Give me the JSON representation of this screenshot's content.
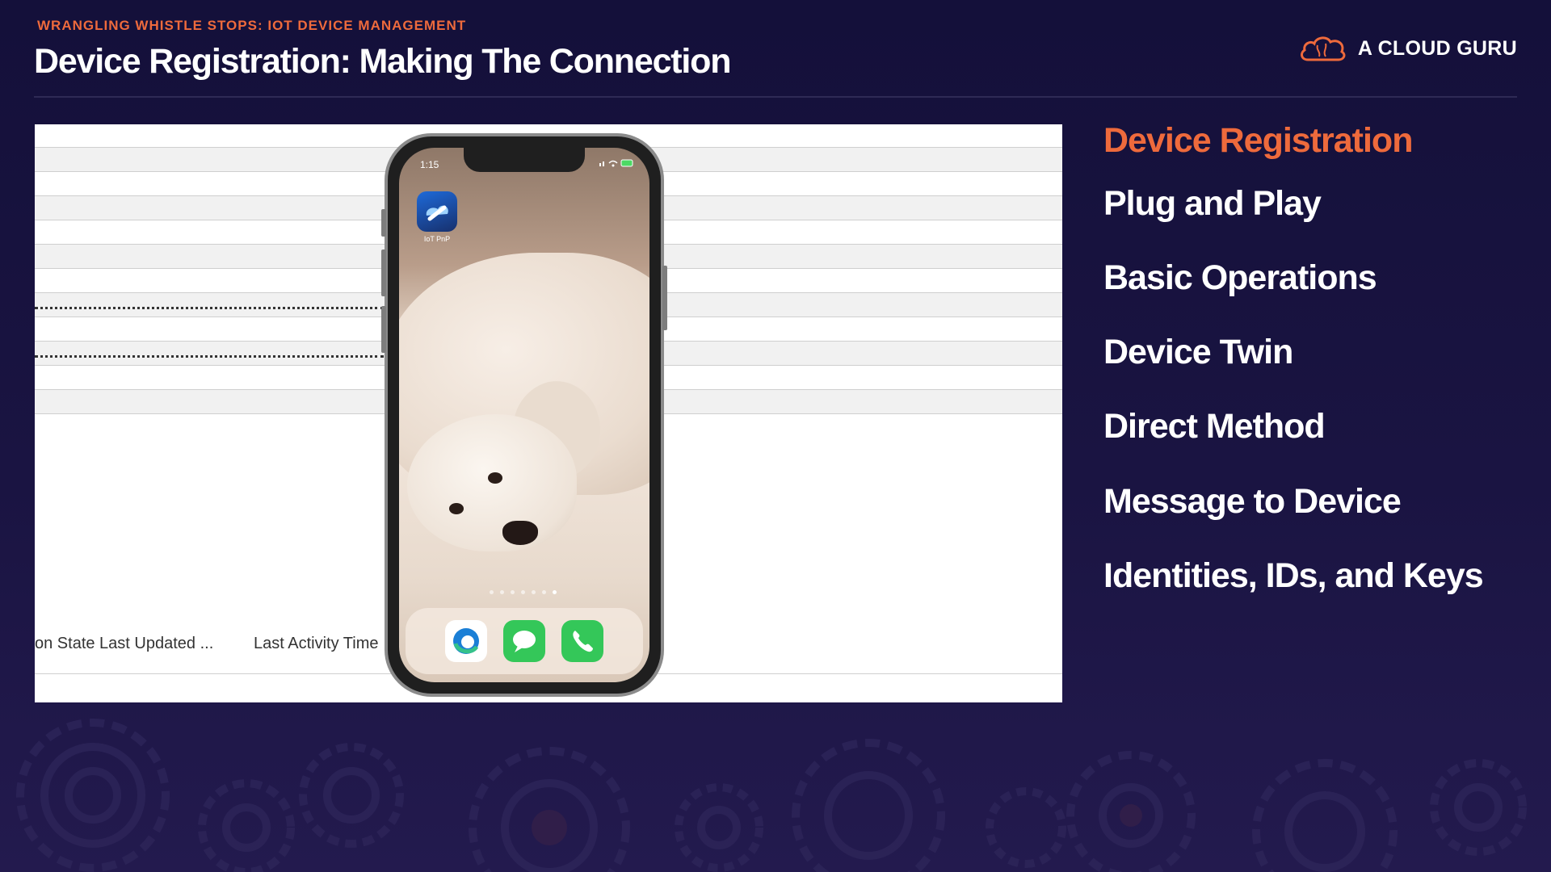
{
  "header": {
    "kicker": "WRANGLING WHISTLE STOPS: IOT DEVICE MANAGEMENT",
    "title": "Device Registration: Making The Connection",
    "brand": "A CLOUD GURU",
    "brand_icon": "cloud-brain-icon"
  },
  "colors": {
    "accent": "#ee6a3c",
    "background": "#1a1442",
    "text": "#ffffff"
  },
  "screenshot": {
    "columns": [
      "on State Last Updated ...",
      "Last Activity Time"
    ],
    "phone": {
      "time": "1:15",
      "app_label": "IoT PnP",
      "dock_apps": [
        "edge-icon",
        "messages-icon",
        "phone-icon"
      ]
    }
  },
  "nav": {
    "items": [
      {
        "label": "Device Registration",
        "active": true
      },
      {
        "label": "Plug and Play",
        "active": false
      },
      {
        "label": "Basic Operations",
        "active": false
      },
      {
        "label": "Device Twin",
        "active": false
      },
      {
        "label": "Direct Method",
        "active": false
      },
      {
        "label": "Message to Device",
        "active": false
      },
      {
        "label": "Identities, IDs, and Keys",
        "active": false
      }
    ]
  }
}
